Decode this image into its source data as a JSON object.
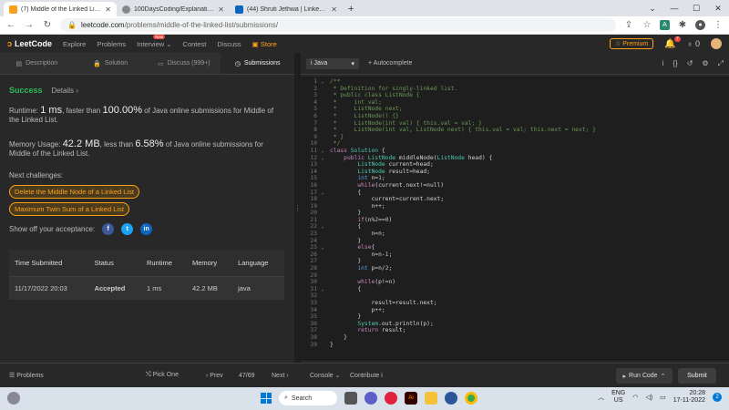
{
  "browser": {
    "tabs": [
      {
        "title": "(7) Middle of the Linked List - Le",
        "favicon_color": "#f89f1b",
        "active": true
      },
      {
        "title": "100DaysCoding/Explanation at m",
        "favicon_color": "#888888",
        "active": false
      },
      {
        "title": "(44) Shruti Jethwa | LinkedIn",
        "favicon_color": "#0a66c2",
        "active": false
      }
    ],
    "url_host": "leetcode.com",
    "url_path": "/problems/middle-of-the-linked-list/submissions/"
  },
  "lcnav": {
    "logo": "LeetCode",
    "items": [
      "Explore",
      "Problems",
      "Interview",
      "Contest",
      "Discuss"
    ],
    "new_badge": "New",
    "store": "Store",
    "premium": "Premium",
    "notif_count": "7",
    "coins": "0"
  },
  "left": {
    "tabs": [
      "Description",
      "Solution",
      "Discuss (999+)",
      "Submissions"
    ],
    "status": "Success",
    "details": "Details",
    "runtime_pre": "Runtime: ",
    "runtime_val": "1 ms",
    "runtime_mid": ", faster than ",
    "runtime_pct": "100.00%",
    "runtime_post": " of Java online submissions for Middle of the Linked List.",
    "memory_pre": "Memory Usage: ",
    "memory_val": "42.2 MB",
    "memory_mid": ", less than ",
    "memory_pct": "6.58%",
    "memory_post": " of Java online submissions for Middle of the Linked List.",
    "next_label": "Next challenges:",
    "challenges": [
      "Delete the Middle Node of a Linked List",
      "Maximum Twin Sum of a Linked List"
    ],
    "showoff": "Show off your acceptance:",
    "table": {
      "headers": [
        "Time Submitted",
        "Status",
        "Runtime",
        "Memory",
        "Language"
      ],
      "row": [
        "11/17/2022 20:03",
        "Accepted",
        "1 ms",
        "42.2 MB",
        "java"
      ]
    }
  },
  "editor": {
    "language": "Java",
    "autocomplete": "Autocomplete",
    "lines": [
      "/**",
      " * Definition for singly-linked list.",
      " * public class ListNode {",
      " *     int val;",
      " *     ListNode next;",
      " *     ListNode() {}",
      " *     ListNode(int val) { this.val = val; }",
      " *     ListNode(int val, ListNode next) { this.val = val; this.next = next; }",
      " * }",
      " */",
      "class Solution {",
      "    public ListNode middleNode(ListNode head) {",
      "        ListNode current=head;",
      "        ListNode result=head;",
      "        int n=1;",
      "        while(current.next!=null)",
      "        {",
      "            current=current.next;",
      "            n++;",
      "        }",
      "        if(n%2==0)",
      "        {",
      "            n=n;",
      "        }",
      "        else{",
      "            n=n-1;",
      "        }",
      "        int p=n/2;",
      "",
      "        while(p!=n)",
      "        {",
      "",
      "            result=result.next;",
      "            p++;",
      "        }",
      "        System.out.println(p);",
      "        return result;",
      "    }",
      "}"
    ]
  },
  "bottom": {
    "problems": "Problems",
    "pick_one": "Pick One",
    "prev": "Prev",
    "count": "47/69",
    "next": "Next",
    "console": "Console",
    "contribute": "Contribute",
    "run": "Run Code",
    "submit": "Submit"
  },
  "taskbar": {
    "search": "Search",
    "lang_top": "ENG",
    "lang_bottom": "US",
    "time": "20:28",
    "date": "17-11-2022"
  }
}
